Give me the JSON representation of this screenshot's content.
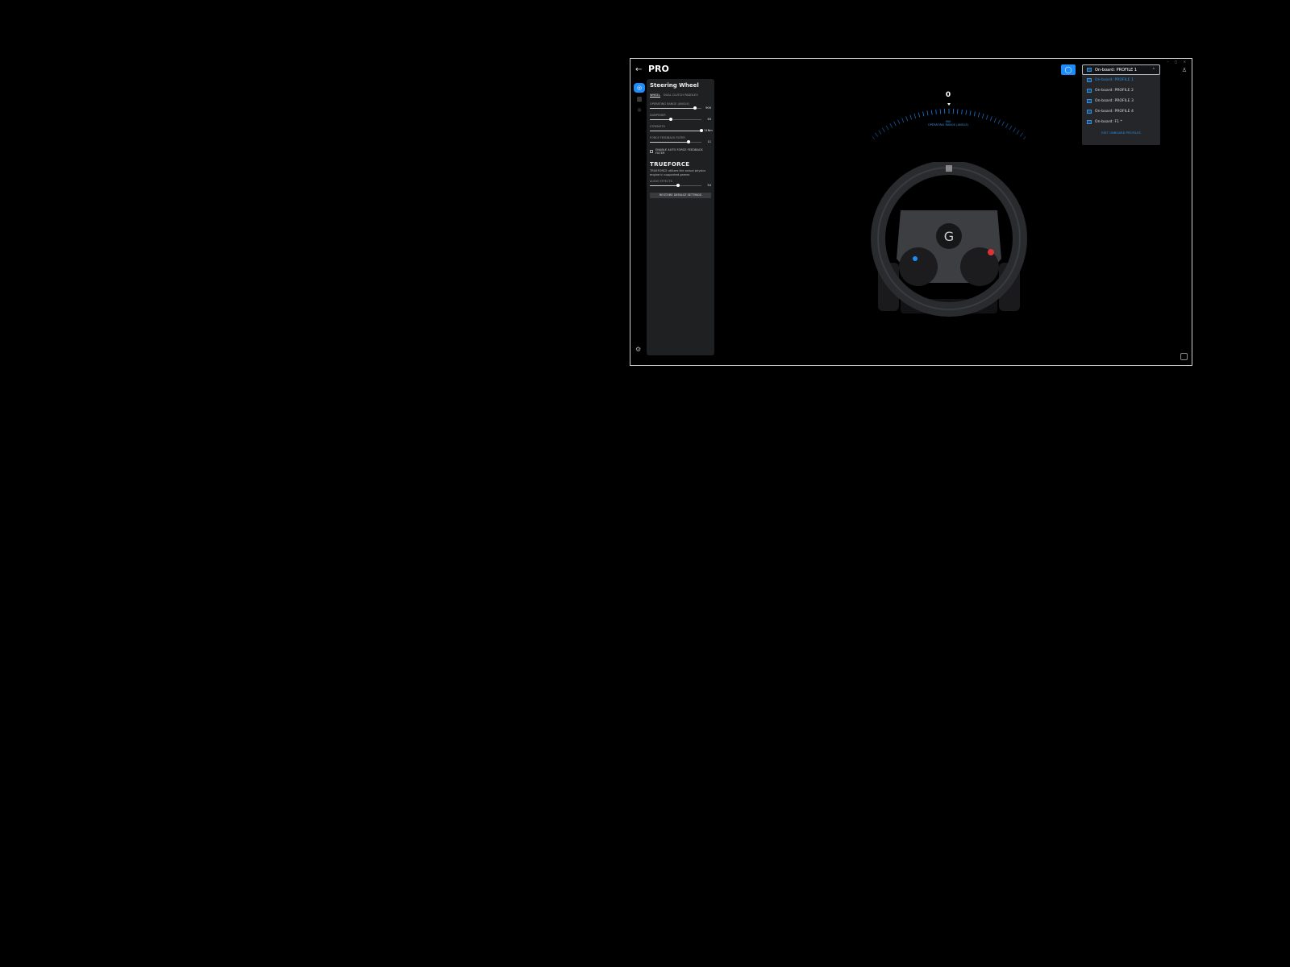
{
  "header": {
    "back_icon": "arrow-left-icon",
    "title": "PRO",
    "window_controls": "– ▢ ×"
  },
  "rail": {
    "items": [
      {
        "icon": "steering-wheel-icon",
        "active": true
      },
      {
        "icon": "pedals-icon"
      },
      {
        "icon": "brightness-icon"
      }
    ],
    "settings_icon": "gear-icon"
  },
  "panel": {
    "title": "Steering Wheel",
    "tabs": [
      "WHEEL",
      "DUAL CLUTCH PADDLES"
    ],
    "sliders": [
      {
        "label": "OPERATING RANGE (ANGLE)",
        "value": "900",
        "fraction": 0.88
      },
      {
        "label": "DAMPENER",
        "value": "40",
        "fraction": 0.4
      },
      {
        "label": "STRENGTH",
        "value": "11Nm",
        "fraction": 1.0
      },
      {
        "label": "FORCE FEEDBACK FILTER",
        "value": "11",
        "fraction": 0.75
      }
    ],
    "checkbox": "ENABLE AUTO FORCE FEEDBACK FILTER",
    "trueforce": {
      "logo": "TRUEFORCE",
      "desc": "TRUEFORCE utilizes the actual physics engine in supported games",
      "audio_label": "AUDIO EFFECTS",
      "audio_value": "54",
      "audio_fraction": 0.54
    },
    "restore": "RESTORE DEFAULT SETTINGS"
  },
  "gauge": {
    "value": "0",
    "range": "900",
    "label": "OPERATING RANGE (ANGLE)",
    "accent": "#1d8cf8"
  },
  "profiles": {
    "selected": "On-board: PROFILE 1",
    "items": [
      "On-board: PROFILE 1",
      "On-board: PROFILE 2",
      "On-board: PROFILE 3",
      "On-board: PROFILE 4",
      "On-board: F1 *"
    ],
    "edit": "EDIT ONBOARD PROFILES"
  }
}
